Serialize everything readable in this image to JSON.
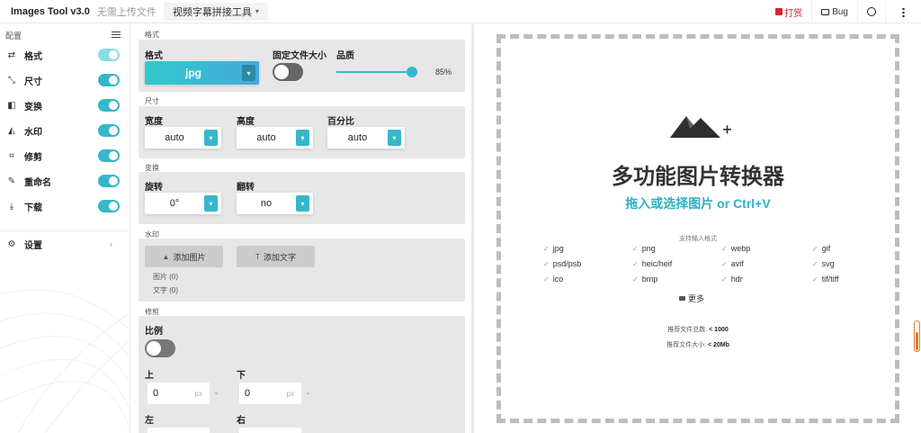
{
  "header": {
    "brand": "Images Tool v3.0",
    "subtitle": "无需上传文件",
    "tool_select": "视频字幕拼接工具",
    "donate": "打赏",
    "bug": "Bug"
  },
  "sidebar": {
    "title": "配置",
    "items": [
      {
        "label": "格式",
        "icon": "format-icon",
        "enabled": true
      },
      {
        "label": "尺寸",
        "icon": "resize-icon",
        "enabled": true
      },
      {
        "label": "变换",
        "icon": "transform-icon",
        "enabled": true
      },
      {
        "label": "水印",
        "icon": "watermark-icon",
        "enabled": true
      },
      {
        "label": "修剪",
        "icon": "crop-icon",
        "enabled": true
      },
      {
        "label": "重命名",
        "icon": "rename-icon",
        "enabled": true
      },
      {
        "label": "下载",
        "icon": "download-icon",
        "enabled": true
      }
    ],
    "settings_label": "设置"
  },
  "format_section": {
    "title": "格式",
    "format_label": "格式",
    "format_value": "jpg",
    "fixed_size_label": "固定文件大小",
    "quality_label": "品质",
    "quality_value": "85%",
    "quality_fraction": 0.85
  },
  "size_section": {
    "title": "尺寸",
    "width_label": "宽度",
    "width_value": "auto",
    "height_label": "高度",
    "height_value": "auto",
    "percent_label": "百分比",
    "percent_value": "auto"
  },
  "transform_section": {
    "title": "变换",
    "rotate_label": "旋转",
    "rotate_value": "0°",
    "flip_label": "翻转",
    "flip_value": "no"
  },
  "watermark_section": {
    "title": "水印",
    "add_image": "添加图片",
    "add_text": "添加文字",
    "image_count": "图片 (0)",
    "text_count": "文字 (0)"
  },
  "crop_section": {
    "title": "修剪",
    "ratio_label": "比例",
    "top_label": "上",
    "top_value": "0",
    "bottom_label": "下",
    "bottom_value": "0",
    "unit": "px",
    "left_label": "左",
    "right_label": "右"
  },
  "dropzone": {
    "title": "多功能图片转换器",
    "subtitle": "拖入或选择图片 or Ctrl+V",
    "formats_heading": "支持输入格式",
    "formats": [
      "jpg",
      "png",
      "webp",
      "gif",
      "psd/psb",
      "heic/heif",
      "avif",
      "svg",
      "ico",
      "bmp",
      "hdr",
      "tif/tiff"
    ],
    "more_label": "更多",
    "rec_count_label": "推荐文件总数:",
    "rec_count_value": "< 1000",
    "rec_size_label": "推荐文件大小:",
    "rec_size_value": "< 20Mb"
  },
  "colors": {
    "accent": "#36b7c9",
    "accent_light": "#89dde6",
    "donate": "#dd2233"
  }
}
